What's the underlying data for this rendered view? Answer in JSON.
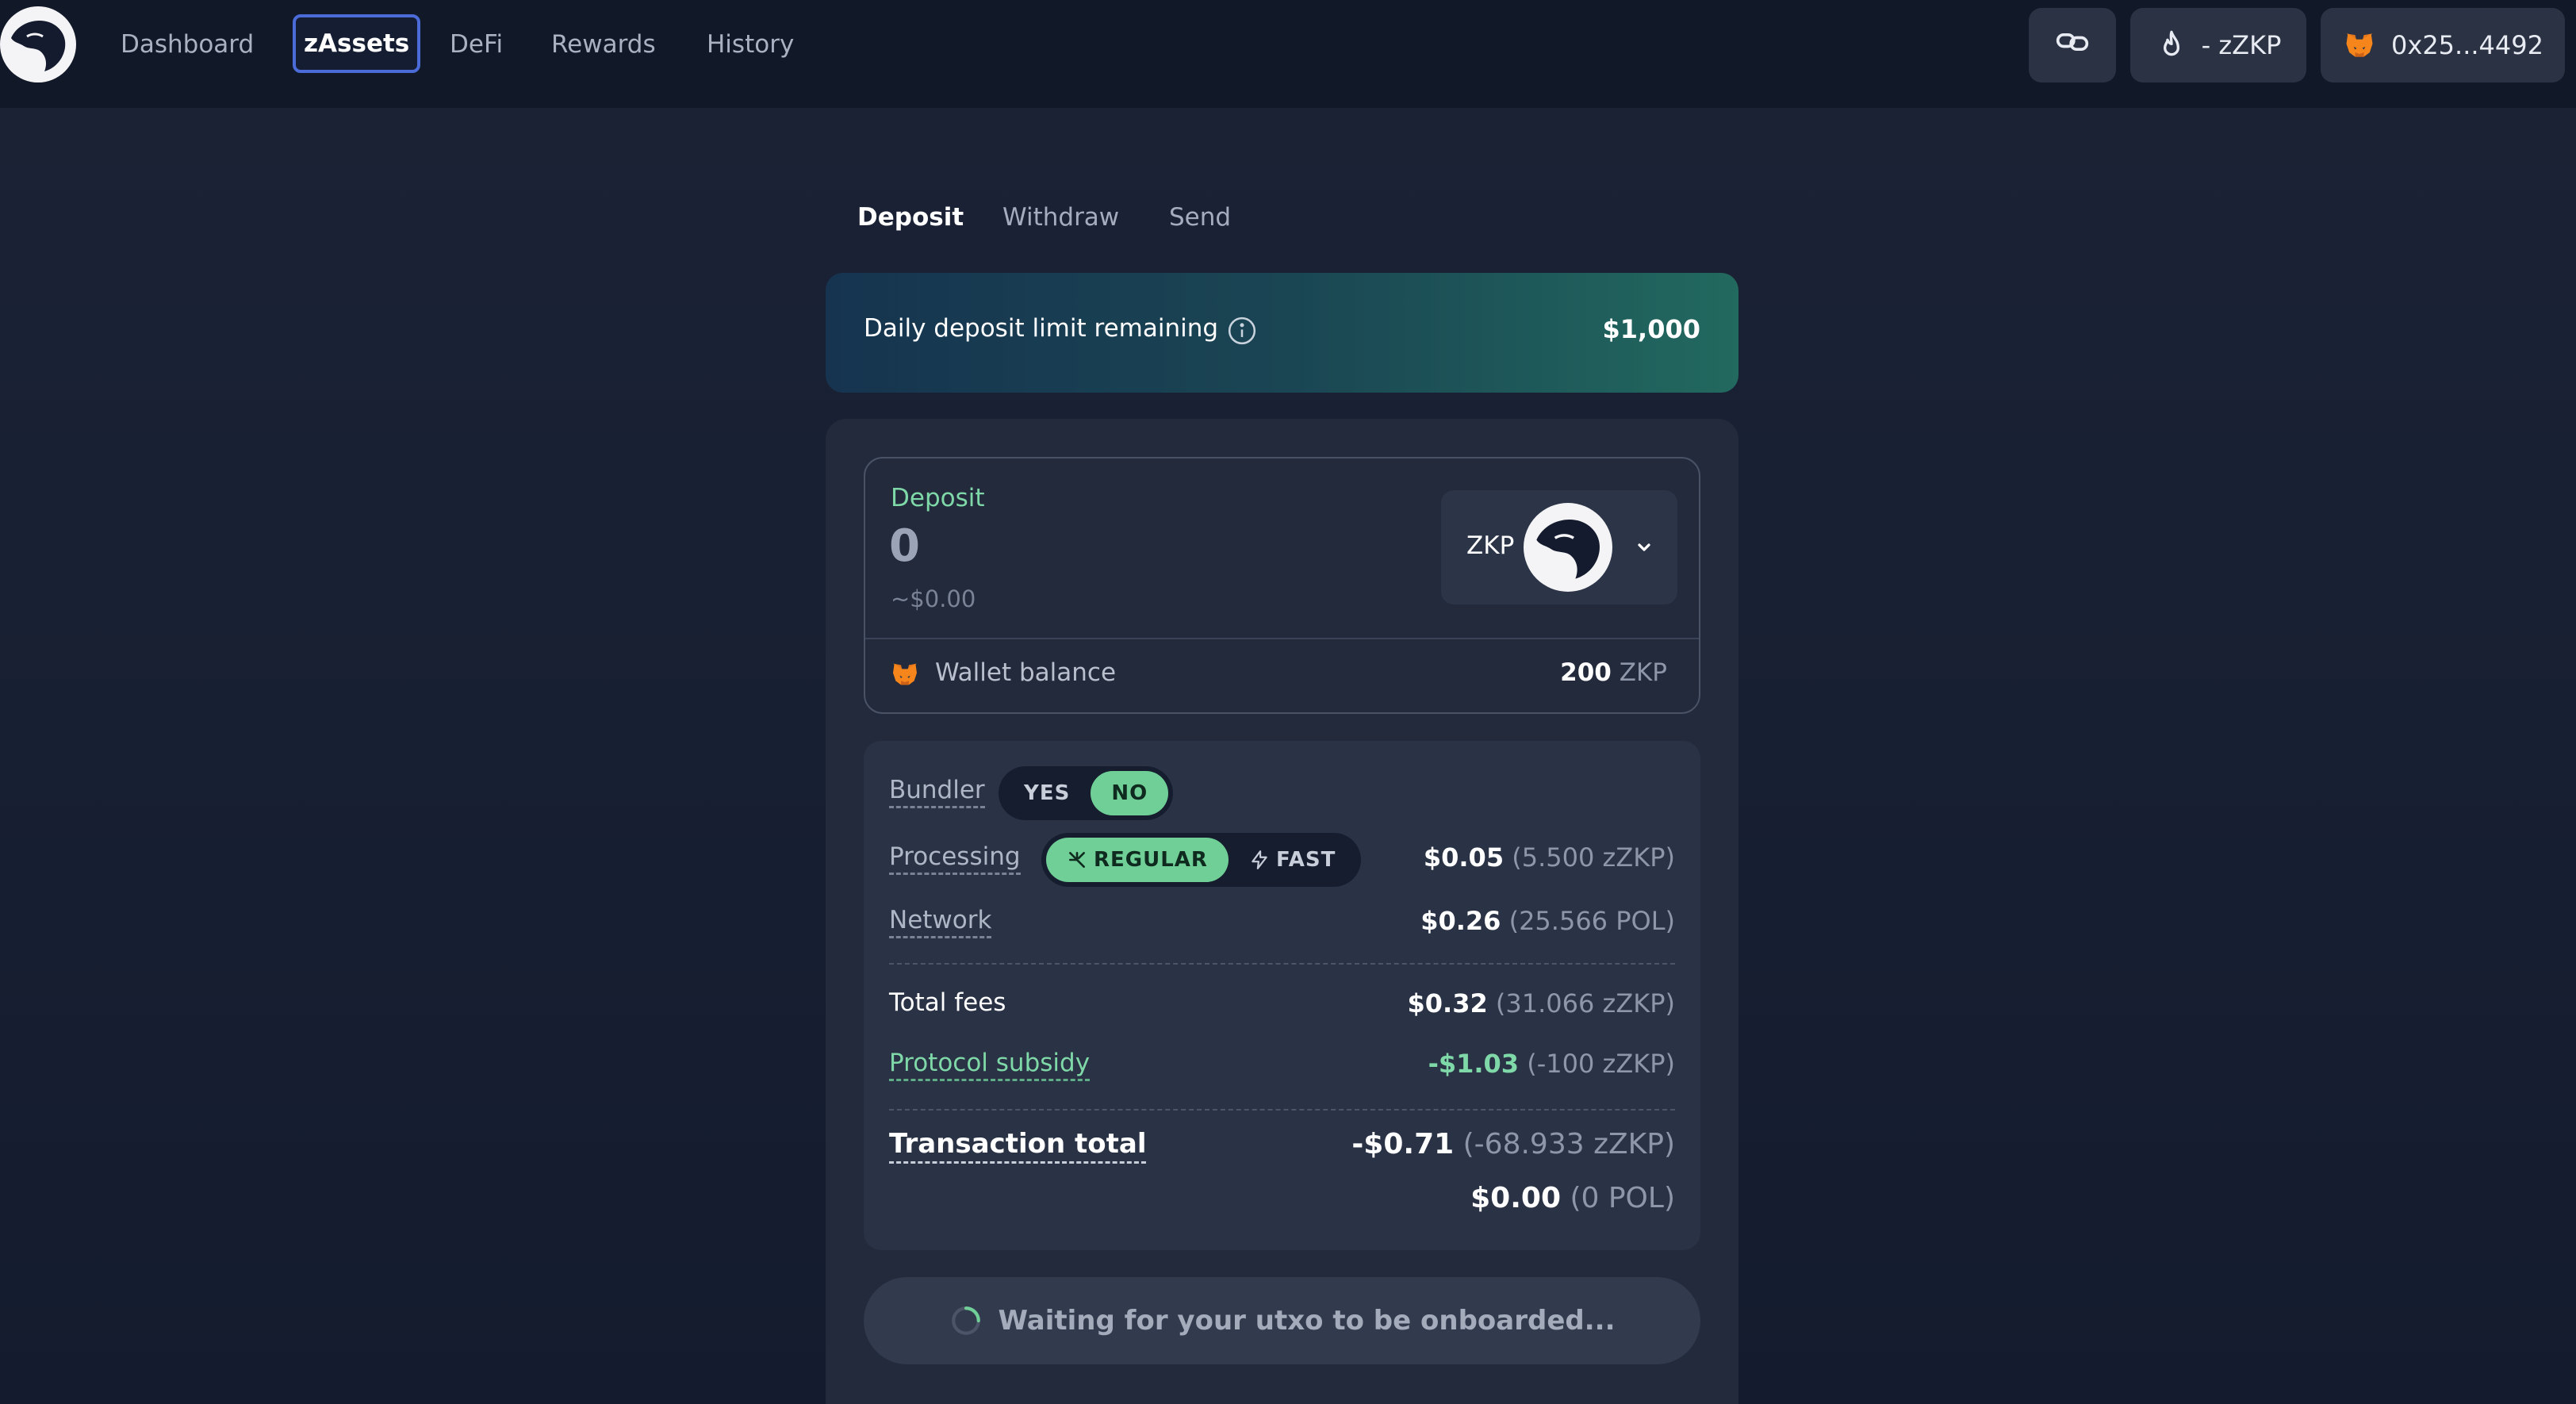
{
  "nav": {
    "items": [
      "Dashboard",
      "zAssets",
      "DeFi",
      "Rewards",
      "History"
    ],
    "active": "zAssets"
  },
  "header": {
    "points_label": "- zZKP",
    "wallet_address": "0x25...4492"
  },
  "tabs": {
    "items": [
      "Deposit",
      "Withdraw",
      "Send"
    ],
    "active": "Deposit"
  },
  "banner": {
    "label": "Daily deposit limit remaining",
    "amount": "$1,000"
  },
  "deposit": {
    "label": "Deposit",
    "value": "0",
    "usd": "~$0.00",
    "token": "ZKP",
    "wallet_label": "Wallet balance",
    "wallet_amount": "200",
    "wallet_unit": "ZKP"
  },
  "fees": {
    "bundler_label": "Bundler",
    "bundler_yes": "YES",
    "bundler_no": "NO",
    "processing_label": "Processing",
    "processing_regular": "REGULAR",
    "processing_fast": "FAST",
    "processing_usd": "$0.05",
    "processing_token": "(5.500 zZKP)",
    "network_label": "Network",
    "network_usd": "$0.26",
    "network_token": "(25.566 POL)",
    "total_label": "Total fees",
    "total_usd": "$0.32",
    "total_token": "(31.066 zZKP)",
    "subsidy_label": "Protocol subsidy",
    "subsidy_usd": "-$1.03",
    "subsidy_token": "(-100 zZKP)",
    "tx_label": "Transaction total",
    "tx_usd": "-$0.71",
    "tx_token": "(-68.933 zZKP)",
    "tx2_usd": "$0.00",
    "tx2_token": "(0 POL)"
  },
  "action": {
    "label": "Waiting for your utxo to be onboarded..."
  },
  "colors": {
    "accent_green": "#6fcf97",
    "active_nav_border": "#4a6bd8"
  }
}
